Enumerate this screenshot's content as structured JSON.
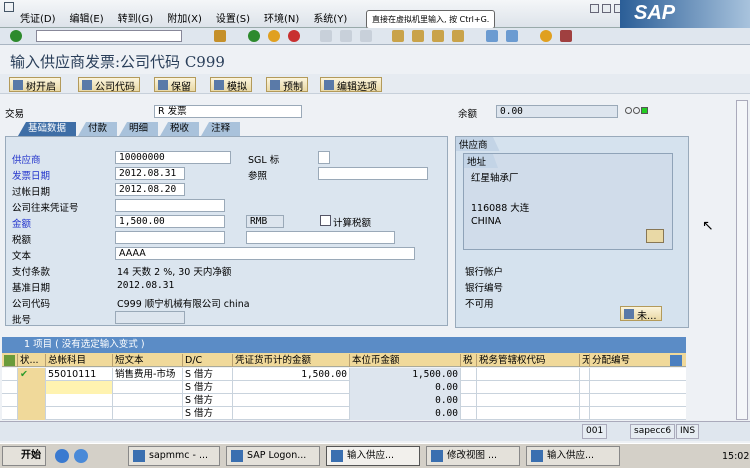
{
  "menu": [
    "凭证(D)",
    "编辑(E)",
    "转到(G)",
    "附加(X)",
    "设置(S)",
    "环境(N)",
    "系统(Y)"
  ],
  "tooltip": "直接在虚拟机里输入, 按 Ctrl+G.",
  "logo": "SAP",
  "title": "输入供应商发票:公司代码 C999",
  "app_buttons": [
    "树开启",
    "公司代码",
    "保留",
    "模拟",
    "预制",
    "编辑选项"
  ],
  "header": {
    "transaction_label": "交易",
    "transaction_value": "R 发票",
    "balance_label": "余额",
    "balance_value": "0.00",
    "status_light": "green"
  },
  "tabs": [
    "基础数据",
    "付款",
    "明细",
    "税收",
    "注释"
  ],
  "form": {
    "vendor_label": "供应商",
    "vendor": "10000000",
    "sgl_label": "SGL 标",
    "sgl": "",
    "inv_date_label": "发票日期",
    "inv_date": "2012.08.31",
    "ref_label": "参照",
    "ref": "",
    "post_date_label": "过帐日期",
    "post_date": "2012.08.20",
    "cross_label": "公司往来凭证号",
    "cross": "",
    "amount_label": "金额",
    "amount": "1,500.00",
    "currency": "RMB",
    "calc_tax_label": "计算税额",
    "tax_label": "税额",
    "tax": "",
    "tax_code": "",
    "text_label": "文本",
    "text": "AAAA",
    "terms_label": "支付条款",
    "terms": "14 天数 2 %, 30 天内净额",
    "baseline_label": "基准日期",
    "baseline": "2012.08.31",
    "company_label": "公司代码",
    "company": "C999 顺宁机械有限公司 china",
    "batch_label": "批号",
    "batch": ""
  },
  "vendor_panel": {
    "title": "供应商",
    "address_title": "地址",
    "name": "红星轴承厂",
    "city": "116088 大连",
    "country": "CHINA",
    "bank_account_label": "银行帐户",
    "bank_key_label": "银行编号",
    "unavailable": "不可用",
    "more_button": "未..."
  },
  "table": {
    "title": "1 项目 ( 没有选定输入变式 )",
    "columns": [
      "状...",
      "总帐科目",
      "短文本",
      "D/C",
      "凭证货币计的金额",
      "本位币金额",
      "税",
      "税务管辖权代码",
      "无",
      "分配编号"
    ],
    "rows": [
      {
        "status": "✔",
        "gl": "55010111",
        "text": "销售费用-市场",
        "dc": "S 借方",
        "doc_amt": "1,500.00",
        "local_amt": "1,500.00"
      },
      {
        "status": "",
        "gl": "",
        "text": "",
        "dc": "S 借方",
        "doc_amt": "",
        "local_amt": "0.00"
      },
      {
        "status": "",
        "gl": "",
        "text": "",
        "dc": "S 借方",
        "doc_amt": "",
        "local_amt": "0.00"
      },
      {
        "status": "",
        "gl": "",
        "text": "",
        "dc": "S 借方",
        "doc_amt": "",
        "local_amt": "0.00"
      }
    ]
  },
  "statusbar": {
    "client": "001",
    "server": "sapecc6",
    "mode": "INS"
  },
  "taskbar": {
    "start": "开始",
    "tasks": [
      "sapmmc - ...",
      "SAP Logon...",
      "输入供应...",
      "修改视图 ...",
      "输入供应..."
    ],
    "clock": "15:02"
  }
}
